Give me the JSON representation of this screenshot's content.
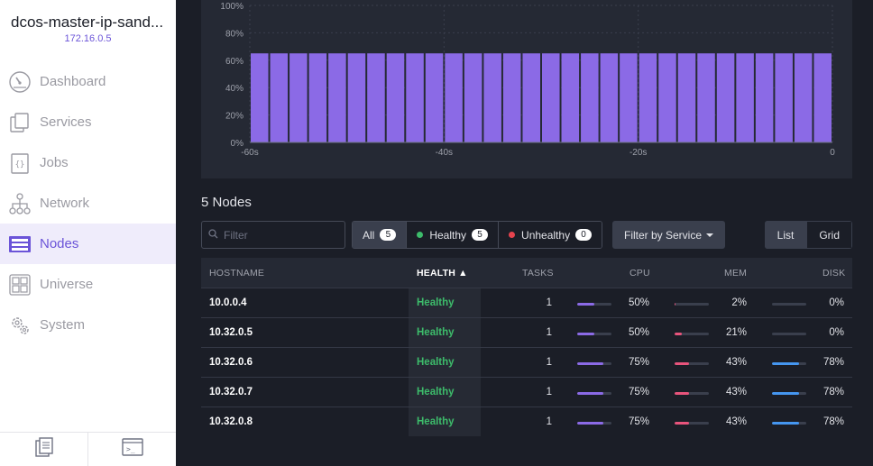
{
  "sidebar": {
    "cluster_name": "dcos-master-ip-sand...",
    "cluster_ip": "172.16.0.5",
    "items": [
      {
        "label": "Dashboard",
        "icon": "dashboard-icon"
      },
      {
        "label": "Services",
        "icon": "services-icon"
      },
      {
        "label": "Jobs",
        "icon": "jobs-icon"
      },
      {
        "label": "Network",
        "icon": "network-icon"
      },
      {
        "label": "Nodes",
        "icon": "nodes-icon",
        "active": true
      },
      {
        "label": "Universe",
        "icon": "universe-icon"
      },
      {
        "label": "System",
        "icon": "system-icon"
      }
    ],
    "footer": [
      "documentation-icon",
      "cli-terminal-icon"
    ]
  },
  "chart_data": {
    "type": "bar",
    "x": [
      -60,
      -58,
      -56,
      -54,
      -52,
      -50,
      -48,
      -46,
      -44,
      -42,
      -40,
      -38,
      -36,
      -34,
      -32,
      -30,
      -28,
      -26,
      -24,
      -22,
      -20,
      -18,
      -16,
      -14,
      -12,
      -10,
      -8,
      -6,
      -4,
      -2
    ],
    "values": [
      65,
      65,
      65,
      65,
      65,
      65,
      65,
      65,
      65,
      65,
      65,
      65,
      65,
      65,
      65,
      65,
      65,
      65,
      65,
      65,
      65,
      65,
      65,
      65,
      65,
      65,
      65,
      65,
      65,
      65
    ],
    "y_ticks": [
      "0%",
      "20%",
      "40%",
      "60%",
      "80%",
      "100%"
    ],
    "x_ticks": [
      "-60s",
      "-40s",
      "-20s",
      "0"
    ],
    "ylim": [
      0,
      100
    ],
    "color": "#8b6ae6"
  },
  "nodes": {
    "title": "5 Nodes",
    "filter_placeholder": "Filter",
    "filters": {
      "all_label": "All",
      "all_count": "5",
      "healthy_label": "Healthy",
      "healthy_count": "5",
      "unhealthy_label": "Unhealthy",
      "unhealthy_count": "0"
    },
    "filter_service_label": "Filter by Service",
    "view_list": "List",
    "view_grid": "Grid",
    "columns": {
      "hostname": "HOSTNAME",
      "health": "HEALTH ▲",
      "tasks": "TASKS",
      "cpu": "CPU",
      "mem": "MEM",
      "disk": "DISK"
    },
    "rows": [
      {
        "hostname": "10.0.0.4",
        "health": "Healthy",
        "tasks": "1",
        "cpu": "50%",
        "mem": "2%",
        "disk": "0%",
        "cpu_v": 0.5,
        "mem_v": 0.02,
        "disk_v": 0.0
      },
      {
        "hostname": "10.32.0.5",
        "health": "Healthy",
        "tasks": "1",
        "cpu": "50%",
        "mem": "21%",
        "disk": "0%",
        "cpu_v": 0.5,
        "mem_v": 0.21,
        "disk_v": 0.0
      },
      {
        "hostname": "10.32.0.6",
        "health": "Healthy",
        "tasks": "1",
        "cpu": "75%",
        "mem": "43%",
        "disk": "78%",
        "cpu_v": 0.75,
        "mem_v": 0.43,
        "disk_v": 0.78
      },
      {
        "hostname": "10.32.0.7",
        "health": "Healthy",
        "tasks": "1",
        "cpu": "75%",
        "mem": "43%",
        "disk": "78%",
        "cpu_v": 0.75,
        "mem_v": 0.43,
        "disk_v": 0.78
      },
      {
        "hostname": "10.32.0.8",
        "health": "Healthy",
        "tasks": "1",
        "cpu": "75%",
        "mem": "43%",
        "disk": "78%",
        "cpu_v": 0.75,
        "mem_v": 0.43,
        "disk_v": 0.78
      }
    ],
    "colors": {
      "cpu": "#8b6ae6",
      "mem": "#e8547c",
      "disk": "#4596f0",
      "healthy": "#3dbc6b",
      "unhealthy": "#e6434e"
    }
  }
}
